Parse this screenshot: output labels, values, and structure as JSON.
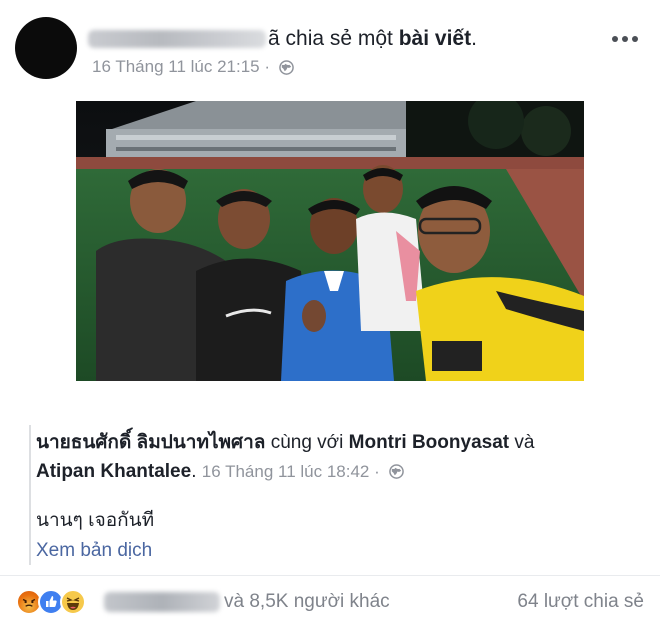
{
  "header": {
    "action_prefix": "ã chia sẻ một ",
    "action_bold": "bài viết",
    "action_suffix": ".",
    "timestamp": "16 Tháng 11 lúc 21:15 ·",
    "privacy_icon": "globe-icon",
    "more_icon": "more-options-icon"
  },
  "photo": {
    "description_icon": "photo-group-selfie"
  },
  "shared_post": {
    "author": "นายธนศักดิ์ ลิมปนาทไพศาล",
    "with_text": " cùng với ",
    "tagged_1": "Montri Boonyasat",
    "and_text": " và ",
    "tagged_2": "Atipan Khantalee",
    "period": ".",
    "timestamp": "16 Tháng 11 lúc 18:42 ·",
    "text": "นานๆ เจอกันที",
    "translate_link": "Xem bản dịch"
  },
  "footer": {
    "reactions_text": "và 8,5K người khác",
    "shares_text": "64 lượt chia sẻ",
    "reaction_icons": [
      "angry-icon",
      "like-icon",
      "haha-icon"
    ]
  },
  "colors": {
    "link": "#4b67a1",
    "meta": "#90949c",
    "text": "#1d2129"
  }
}
